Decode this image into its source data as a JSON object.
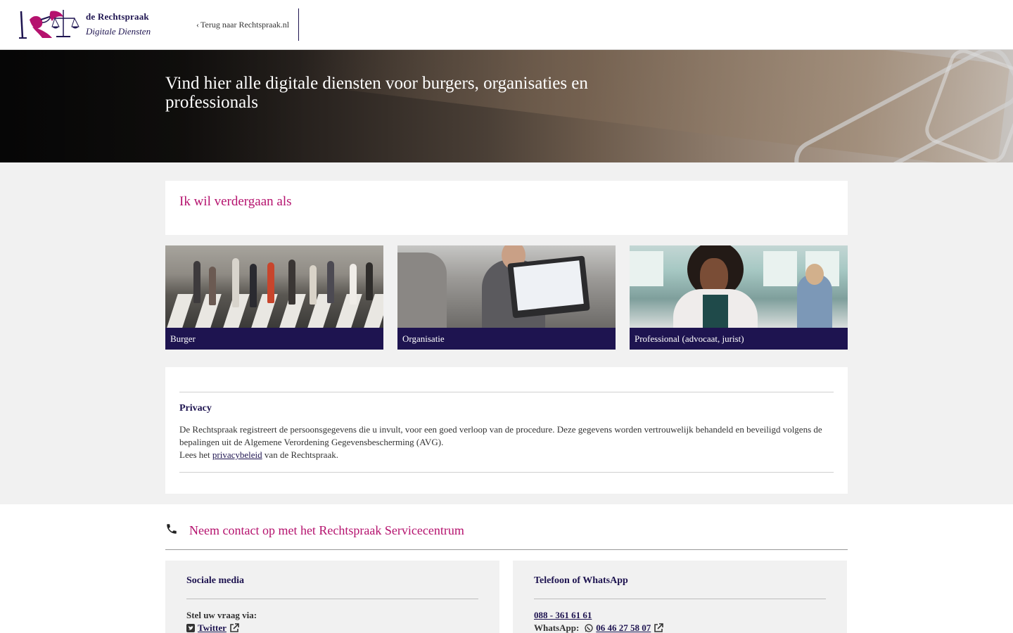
{
  "header": {
    "brand_name": "de Rechtspraak",
    "brand_sub": "Digitale Diensten",
    "back_link": "Terug naar Rechtspraak.nl"
  },
  "hero": {
    "title": "Vind hier alle digitale diensten voor burgers, organisaties en professionals"
  },
  "choose": {
    "title": "Ik wil verdergaan als",
    "cards": [
      {
        "label": "Burger",
        "icon": "street-crowd-photo"
      },
      {
        "label": "Organisatie",
        "icon": "office-laptop-photo"
      },
      {
        "label": "Professional (advocaat, jurist)",
        "icon": "professional-woman-photo"
      }
    ]
  },
  "privacy": {
    "title": "Privacy",
    "text": "De Rechtspraak registreert de persoonsgegevens die u invult, voor een goed verloop van de procedure. Deze gegevens worden vertrouwelijk behandeld en beveiligd volgens de bepalingen uit de Algemene Verordening Gegevensbescherming (AVG).",
    "read_prefix": "Lees het",
    "link": "privacybeleid",
    "read_suffix": "van de Rechtspraak."
  },
  "contact": {
    "title": "Neem contact op met het Rechtspraak Servicecentrum",
    "social": {
      "title": "Sociale media",
      "ask_via": "Stel uw vraag via:",
      "twitter": "Twitter"
    },
    "phone": {
      "title": "Telefoon of WhatsApp",
      "number": "088 - 361 61 61",
      "whatsapp_label": "WhatsApp:",
      "whatsapp_number": "06 46 27 58 07"
    }
  },
  "colors": {
    "brand_navy": "#1e1450",
    "brand_magenta": "#b5126e",
    "background": "#f1f1f1"
  }
}
